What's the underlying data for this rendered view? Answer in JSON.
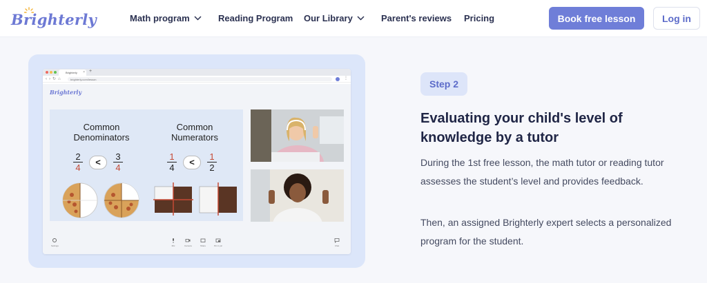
{
  "nav": {
    "logo_text": "Brighterly",
    "items": [
      {
        "label": "Math program",
        "has_dropdown": true
      },
      {
        "label": "Reading Program",
        "has_dropdown": false
      },
      {
        "label": "Our Library",
        "has_dropdown": true
      },
      {
        "label": "Parent's reviews",
        "has_dropdown": false
      },
      {
        "label": "Pricing",
        "has_dropdown": false
      }
    ],
    "cta_label": "Book free lesson",
    "login_label": "Log in"
  },
  "illustration": {
    "browser": {
      "tab_title": "Brighterly",
      "url": "brighterly.com/lesson",
      "app_logo": "Brighterly"
    },
    "lesson": {
      "left_topic": "Common\nDenominators",
      "left_fraction_a": {
        "num": "2",
        "den": "4"
      },
      "left_fraction_b": {
        "num": "3",
        "den": "4"
      },
      "left_comparator": "<",
      "right_topic": "Common\nNumerators",
      "right_fraction_a": {
        "num": "1",
        "den": "4"
      },
      "right_fraction_b": {
        "num": "1",
        "den": "2"
      },
      "right_comparator": "<"
    },
    "controls": [
      "Settings",
      "Mic",
      "Camera",
      "Share",
      "Pic in pic",
      "Chat"
    ]
  },
  "content": {
    "step_badge": "Step 2",
    "heading": "Evaluating your child's level of knowledge by a tutor",
    "paragraph_1": "During the 1st free lesson, the math tutor or reading tutor  assesses the student’s level and provides feedback.",
    "paragraph_2": "Then, an assigned Brighterly expert selects  a personalized program for the student."
  },
  "colors": {
    "brand": "#6f7ed8",
    "card_bg": "#dce6fa",
    "heading": "#1f2545"
  }
}
